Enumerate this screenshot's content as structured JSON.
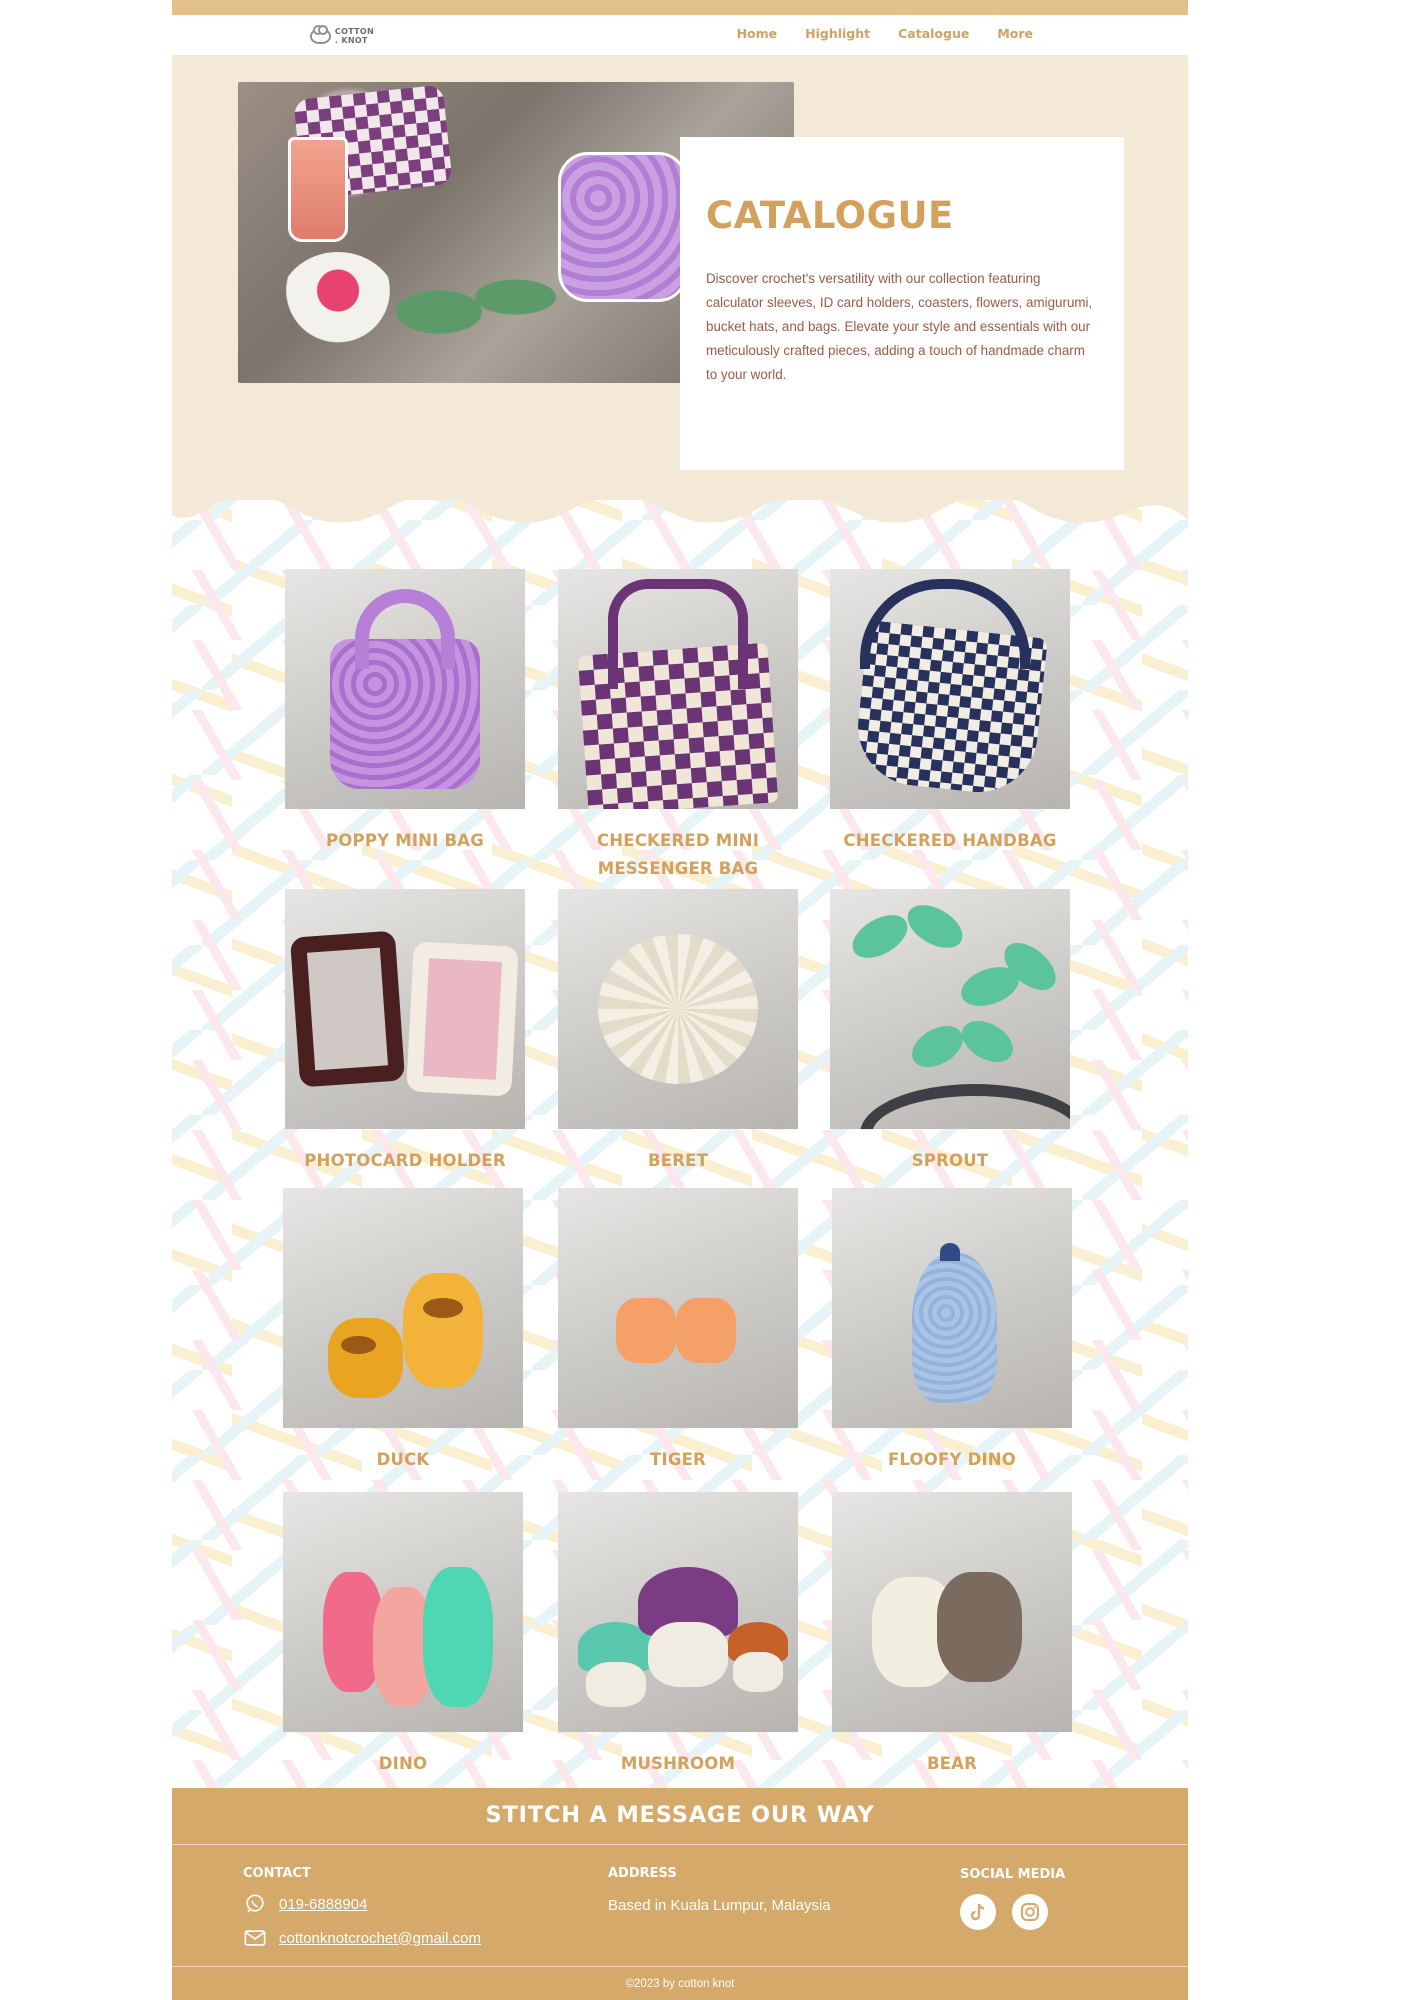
{
  "brand": {
    "logo_line1": "COTTON",
    "logo_line2": ". KNOT"
  },
  "nav": {
    "items": [
      {
        "label": "Home"
      },
      {
        "label": "Highlight"
      },
      {
        "label": "Catalogue"
      },
      {
        "label": "More"
      }
    ]
  },
  "hero": {
    "title": "CATALOGUE",
    "description": "Discover crochet's versatility with our collection featuring calculator sleeves, ID card holders, coasters, flowers, amigurumi, bucket hats, and bags. Elevate your style and essentials with our meticulously crafted pieces, adding a touch of handmade charm to your world."
  },
  "catalogue": {
    "items": [
      {
        "label": "POPPY MINI BAG"
      },
      {
        "label": "CHECKERED MINI MESSENGER BAG"
      },
      {
        "label": "CHECKERED HANDBAG"
      },
      {
        "label": "PHOTOCARD HOLDER"
      },
      {
        "label": "BERET"
      },
      {
        "label": "SPROUT"
      },
      {
        "label": "DUCK"
      },
      {
        "label": "TIGER"
      },
      {
        "label": "FLOOFY DINO"
      },
      {
        "label": "DINO"
      },
      {
        "label": "MUSHROOM"
      },
      {
        "label": "BEAR"
      }
    ]
  },
  "footer": {
    "title": "STITCH A MESSAGE OUR WAY",
    "contact_heading": "CONTACT",
    "phone": "019-6888904",
    "email": "cottonknotcrochet@gmail.com",
    "address_heading": "ADDRESS",
    "address": "Based in Kuala Lumpur, Malaysia",
    "social_heading": "SOCIAL MEDIA",
    "social": [
      "tiktok-icon",
      "instagram-icon"
    ],
    "copyright": "©2023 by cotton knot"
  },
  "colors": {
    "accent": "#d4a15c",
    "hero_bg": "#f4e8d6",
    "footer_bg": "#d4a96a",
    "top_stripe": "#e3c08a",
    "body_text": "#9a5b4a"
  }
}
